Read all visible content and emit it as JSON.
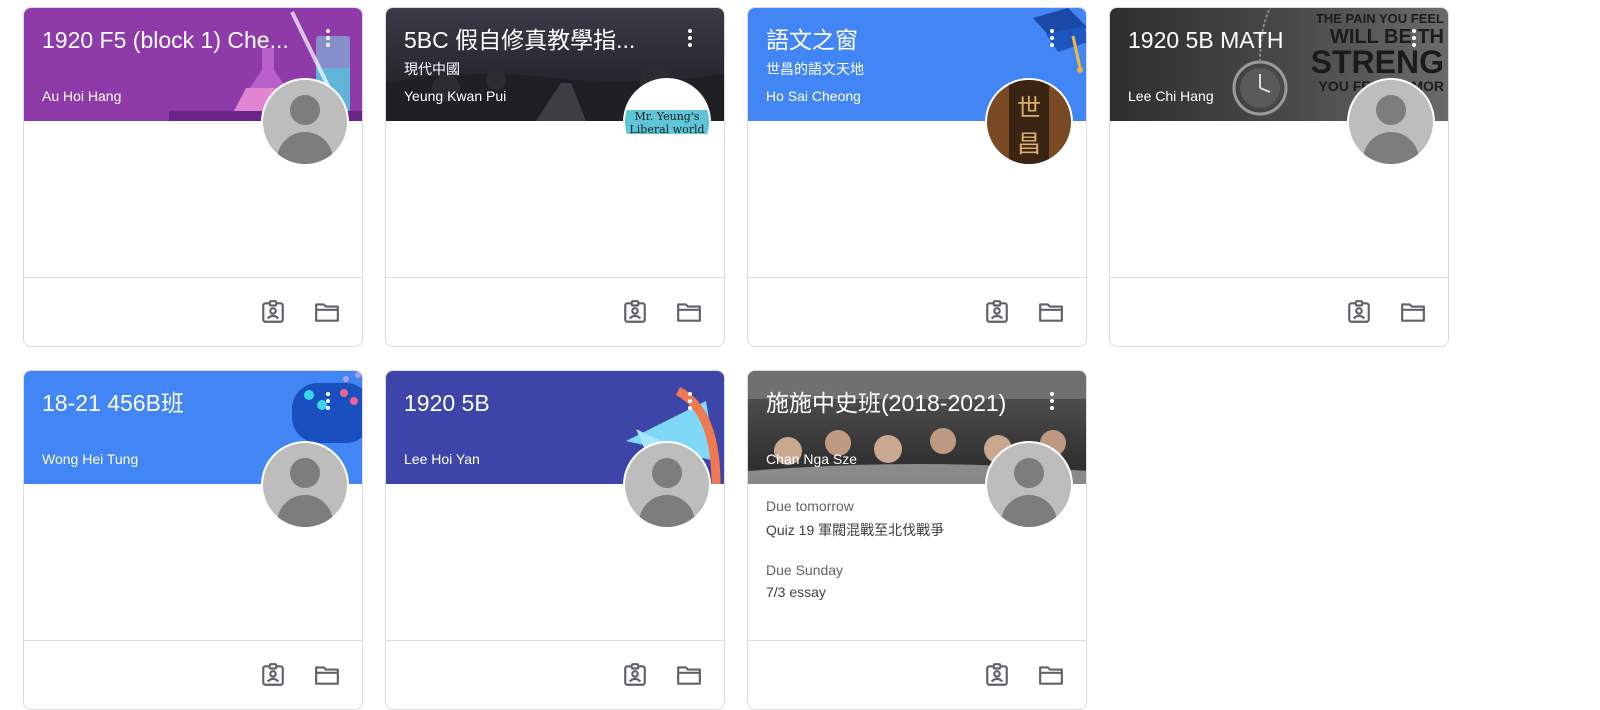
{
  "colors": {
    "purple": "#8e24aa",
    "blue": "#4285f4",
    "indigo": "#3949ab",
    "dark": "#3c4043"
  },
  "cards": [
    {
      "title": "1920 F5 (block 1) Che...",
      "subtitle": "",
      "teacher": "Au Hoi Hang"
    },
    {
      "title": "5BC 假自修真教學指...",
      "subtitle": "現代中國",
      "teacher": "Yeung Kwan Pui",
      "avatar_text": [
        "Mr. Yeung's",
        "Liberal world"
      ]
    },
    {
      "title": "語文之窗",
      "subtitle": "世昌的語文天地",
      "teacher": "Ho Sai Cheong",
      "avatar_text": [
        "世",
        "昌"
      ]
    },
    {
      "title": "1920 5B MATH",
      "subtitle": "",
      "teacher": "Lee Chi Hang",
      "bg_text": [
        "THE PAIN YOU FEEL",
        "WILL BE TH",
        "STRENG",
        "YOU FEEL TOMOR"
      ]
    },
    {
      "title": "18-21 456B班",
      "subtitle": "",
      "teacher": "Wong Hei Tung"
    },
    {
      "title": "1920 5B",
      "subtitle": "",
      "teacher": "Lee Hoi Yan"
    },
    {
      "title": "施施中史班(2018-2021)",
      "subtitle": "",
      "teacher": "Chan Nga Sze",
      "due": [
        {
          "when": "Due tomorrow",
          "task": "Quiz 19 軍閥混戰至北伐戰爭"
        },
        {
          "when": "Due Sunday",
          "task": "7/3 essay"
        }
      ]
    }
  ]
}
